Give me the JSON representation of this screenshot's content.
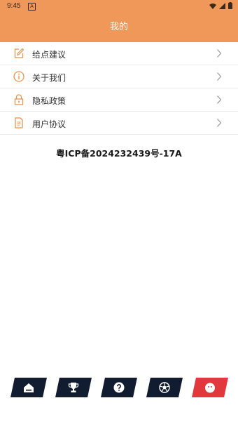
{
  "status_bar": {
    "time": "9:45",
    "notification_glyph": "A"
  },
  "app_bar": {
    "title": "我的"
  },
  "menu": [
    {
      "label": "给点建议",
      "icon": "edit-icon"
    },
    {
      "label": "关于我们",
      "icon": "info-icon"
    },
    {
      "label": "隐私政策",
      "icon": "lock-icon"
    },
    {
      "label": "用户协议",
      "icon": "document-icon"
    }
  ],
  "icp": "粤ICP备2024232439号-17A",
  "tabs": [
    {
      "icon": "home-icon",
      "active": false
    },
    {
      "icon": "trophy-icon",
      "active": false
    },
    {
      "icon": "question-icon",
      "active": false
    },
    {
      "icon": "football-icon",
      "active": false
    },
    {
      "icon": "profile-icon",
      "active": true
    }
  ],
  "colors": {
    "accent": "#f0975a",
    "tab_dark": "#121c31",
    "tab_active": "#e0383d",
    "icon_orange": "#e8944f"
  }
}
